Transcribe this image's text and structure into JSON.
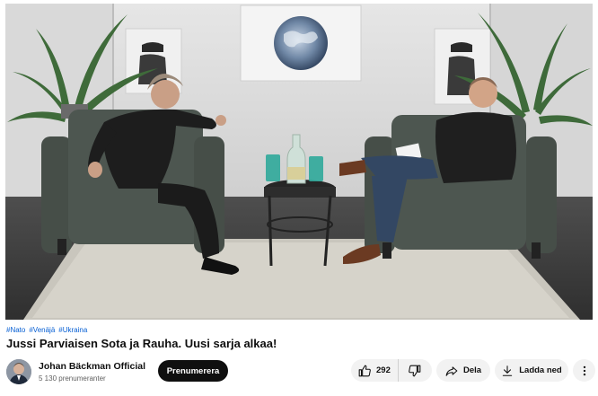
{
  "video": {
    "description": "Two men seated in dark green armchairs in a studio with a side table, water bottle and two green glasses"
  },
  "hashtags": [
    "#Nato",
    "#Venäjä",
    "#Ukraina"
  ],
  "title": "Jussi Parviaisen Sota ja Rauha. Uusi sarja alkaa!",
  "channel": {
    "name": "Johan Bäckman Official",
    "subscribers": "5 130 prenumeranter",
    "subscribe_label": "Prenumerera"
  },
  "actions": {
    "like_count": "292",
    "share_label": "Dela",
    "download_label": "Ladda ned"
  },
  "icons": {
    "like": "thumbs-up-icon",
    "dislike": "thumbs-down-icon",
    "share": "share-arrow-icon",
    "download": "download-icon",
    "more": "more-vertical-icon"
  }
}
